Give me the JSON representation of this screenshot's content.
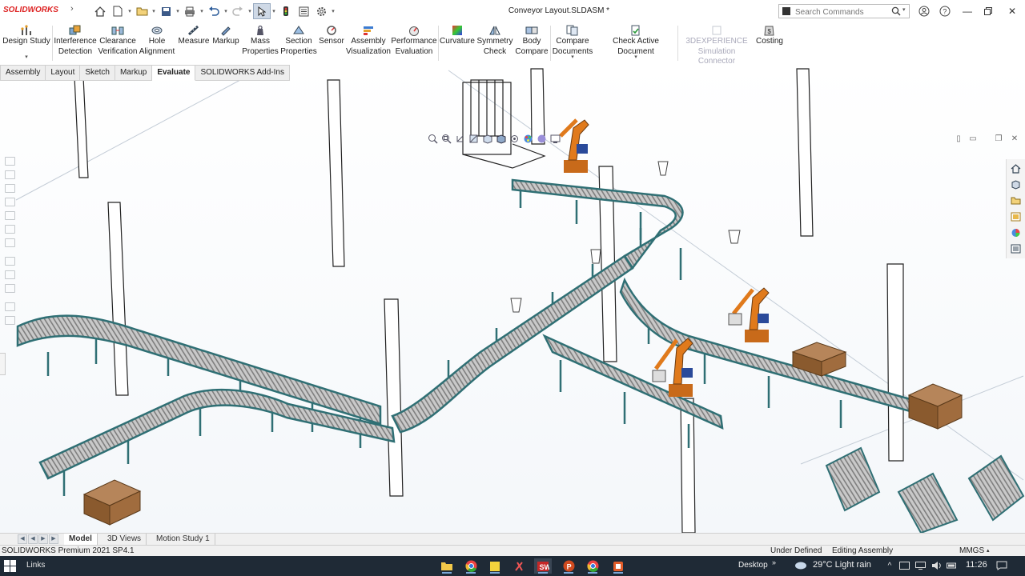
{
  "app": {
    "logo": "SOLIDWORKS",
    "document_title": "Conveyor Layout.SLDASM *"
  },
  "search": {
    "placeholder": "Search Commands",
    "value": ""
  },
  "ribbon": {
    "design_study": "Design Study",
    "interference": "Interference\nDetection",
    "clearance": "Clearance\nVerification",
    "hole_alignment": "Hole\nAlignment",
    "measure": "Measure",
    "markup": "Markup",
    "mass_properties": "Mass\nProperties",
    "section_properties": "Section\nProperties",
    "sensor": "Sensor",
    "assembly_visualization": "Assembly\nVisualization",
    "performance_evaluation": "Performance\nEvaluation",
    "curvature": "Curvature",
    "symmetry_check": "Symmetry\nCheck",
    "body_compare": "Body\nCompare",
    "compare_documents": "Compare\nDocuments",
    "check_active_document": "Check Active Document",
    "simulation_connector": "3DEXPERIENCE\nSimulation Connector",
    "costing": "Costing"
  },
  "command_tabs": [
    "Assembly",
    "Layout",
    "Sketch",
    "Markup",
    "Evaluate",
    "SOLIDWORKS Add-Ins"
  ],
  "active_command_tab": "Evaluate",
  "bottom_tabs": [
    "Model",
    "3D Views",
    "Motion Study 1"
  ],
  "active_bottom_tab": "Model",
  "status": {
    "product": "SOLIDWORKS Premium 2021 SP4.1",
    "definition": "Under Defined",
    "mode": "Editing Assembly",
    "units": "MMGS"
  },
  "taskbar": {
    "links": "Links",
    "desktop": "Desktop",
    "weather": "29°C  Light rain",
    "time": "11:26"
  },
  "colors": {
    "robot": "#e07a1c",
    "conveyor_frame": "#2f6f74",
    "roller": "#c9c9c9",
    "box": "#9a6a3e",
    "taskbar": "#1f2a36"
  },
  "icons": {
    "scene": "conveyor-layout-3d-model"
  }
}
